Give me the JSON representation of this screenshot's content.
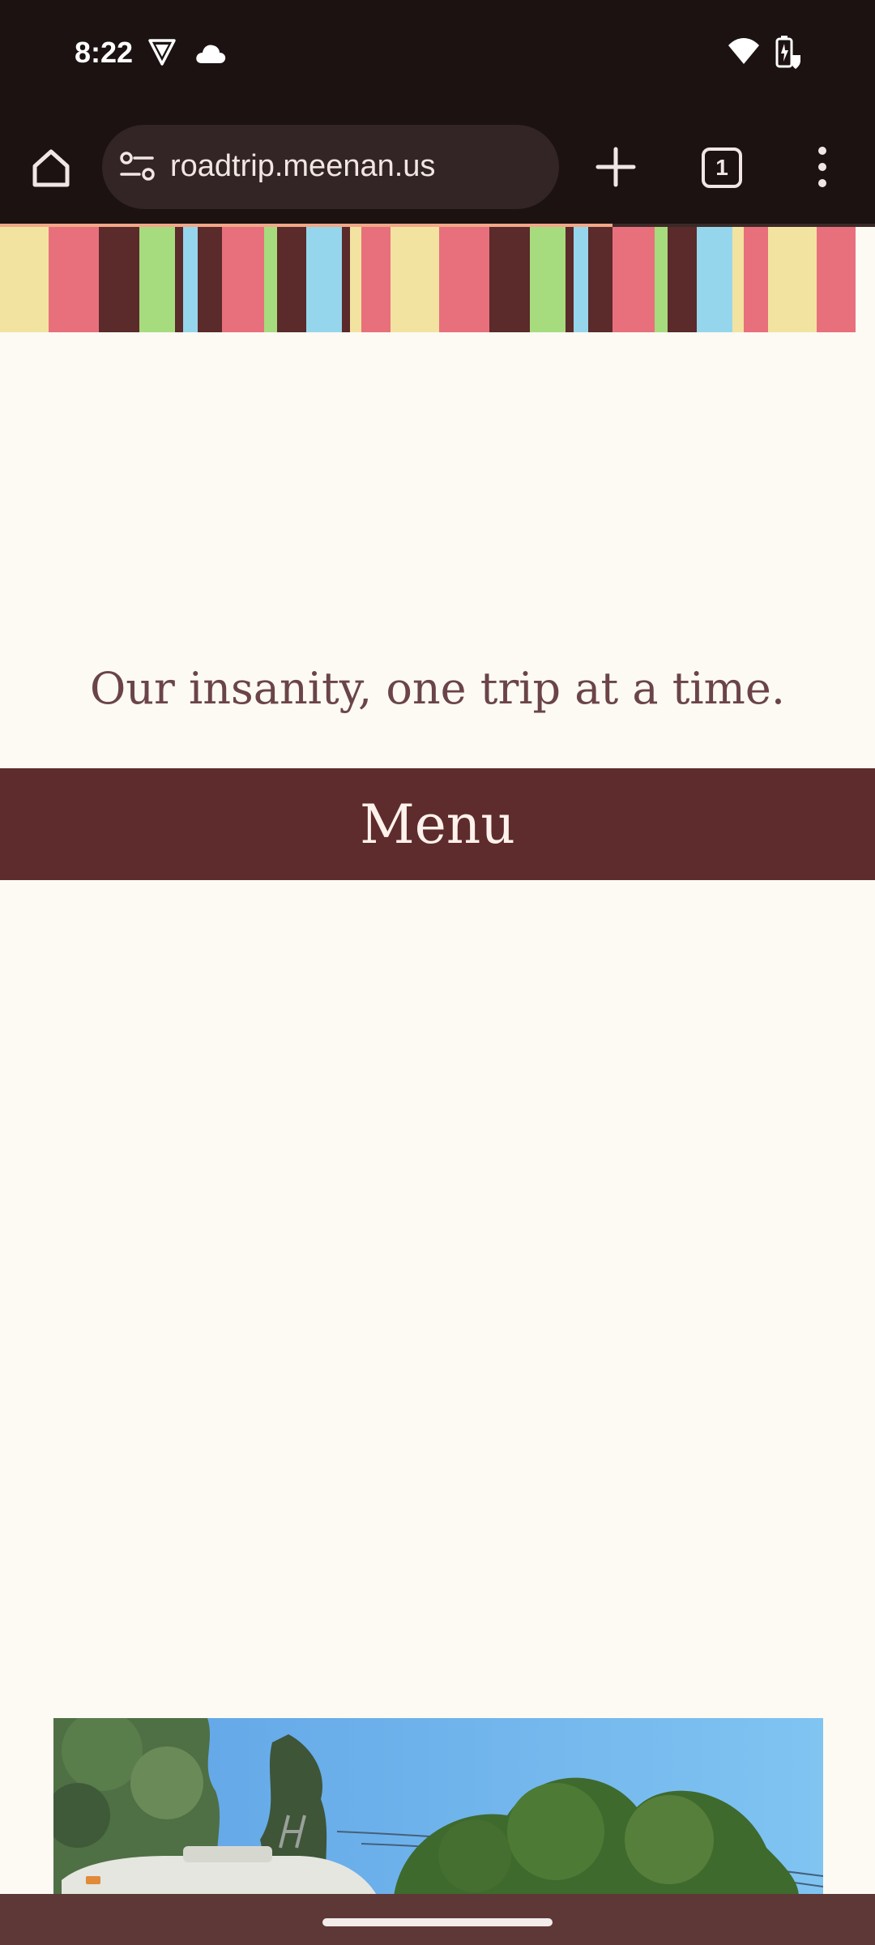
{
  "status_bar": {
    "time": "8:22",
    "icons": [
      "vpn-shield-icon",
      "cloud-icon",
      "wifi-icon",
      "battery-icon"
    ]
  },
  "browser": {
    "url": "roadtrip.meenan.us",
    "tab_count": "1",
    "load_progress": 0.7,
    "icons": [
      "home-icon",
      "site-settings-icon",
      "plus-icon",
      "more-vert-icon"
    ]
  },
  "page": {
    "tagline": "Our insanity, one trip at a time.",
    "menu_label": "Menu"
  },
  "colors": {
    "chrome_bg": "#1c1212",
    "page_bg": "#fcfaf3",
    "menu_bar": "#5e2c2c",
    "tagline_text": "#6b4448",
    "stripe_palette": [
      "#f2e3a0",
      "#e8707c",
      "#5b2a2a",
      "#a6dc7e",
      "#96d6ec"
    ]
  }
}
